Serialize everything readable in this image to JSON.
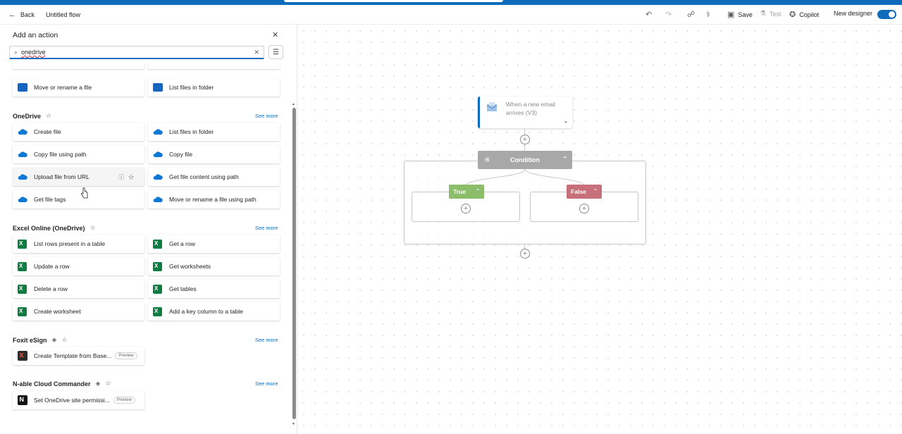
{
  "header": {
    "back_label": "Back",
    "flow_name": "Untitled flow",
    "save_label": "Save",
    "test_label": "Test",
    "copilot_label": "Copilot",
    "new_designer_label": "New designer",
    "new_designer_on": true
  },
  "panel": {
    "title": "Add an action",
    "search_value": "onedrive",
    "top_items": [
      "Move or rename a file",
      "List files in folder"
    ],
    "sections": [
      {
        "name": "OneDrive",
        "see_more": "See more",
        "items": [
          "Create file",
          "List files in folder",
          "Copy file using path",
          "Copy file",
          "Upload file from URL",
          "Get file content using path",
          "Get file tags",
          "Move or rename a file using path"
        ]
      },
      {
        "name": "Excel Online (OneDrive)",
        "see_more": "See more",
        "items": [
          "List rows present in a table",
          "Get a row",
          "Update a row",
          "Get worksheets",
          "Delete a row",
          "Get tables",
          "Create worksheet",
          "Add a key column to a table"
        ]
      },
      {
        "name": "Foxit eSign",
        "see_more": "See more",
        "premium": true,
        "items": [
          "Create Template from Base..."
        ],
        "badge": "Preview"
      },
      {
        "name": "N-able Cloud Commander",
        "see_more": "See more",
        "premium": true,
        "items": [
          "Set OneDrive site permissi..."
        ],
        "badge": "Preview"
      }
    ]
  },
  "canvas": {
    "trigger_title": "When a new email arrives (V3)",
    "condition_label": "Condition",
    "true_label": "True",
    "false_label": "False",
    "colors": {
      "true": "#8cbd6b",
      "false": "#c7707a",
      "condition": "#a8a8a8",
      "accent": "#0f6cbd"
    }
  }
}
